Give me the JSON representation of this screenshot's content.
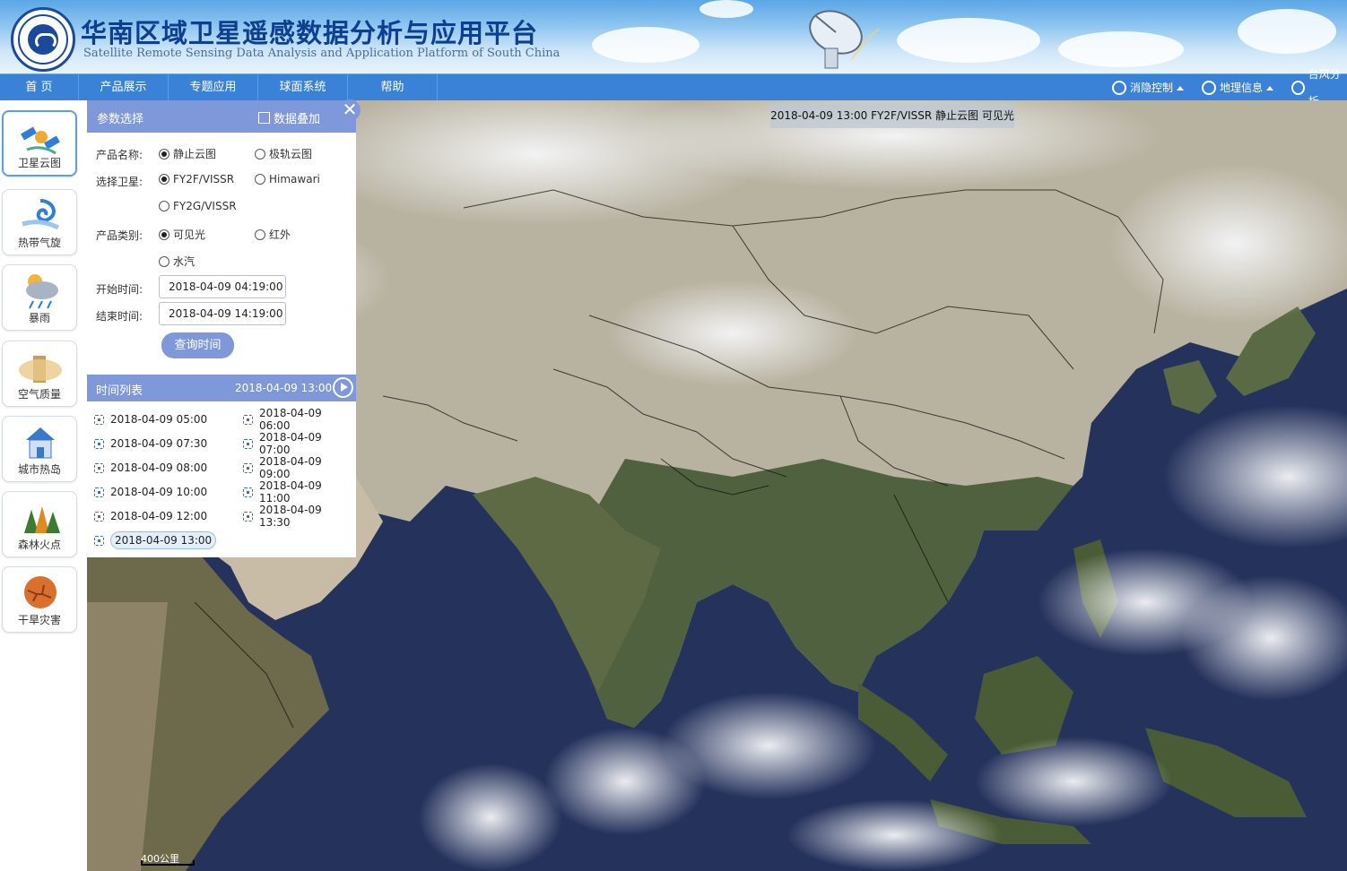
{
  "header": {
    "title": "华南区域卫星遥感数据分析与应用平台",
    "subtitle": "Satellite Remote Sensing Data Analysis and Application Platform of South China"
  },
  "nav": {
    "items": [
      "首 页",
      "产品展示",
      "专题应用",
      "球面系统",
      "帮助"
    ],
    "right": [
      {
        "label": "消隐控制",
        "icon": "gear-icon"
      },
      {
        "label": "地理信息",
        "icon": "globe-icon"
      },
      {
        "label": "台风分析",
        "icon": "typhoon-icon"
      }
    ]
  },
  "sidebar": {
    "items": [
      {
        "label": "卫星云图",
        "icon": "satellite-icon",
        "active": true
      },
      {
        "label": "热带气旋",
        "icon": "cyclone-icon",
        "active": false
      },
      {
        "label": "暴雨",
        "icon": "rainstorm-icon",
        "active": false
      },
      {
        "label": "空气质量",
        "icon": "air-quality-icon",
        "active": false
      },
      {
        "label": "城市热岛",
        "icon": "city-heat-island-icon",
        "active": false
      },
      {
        "label": "森林火点",
        "icon": "forest-fire-icon",
        "active": false
      },
      {
        "label": "干旱灾害",
        "icon": "drought-icon",
        "active": false
      }
    ]
  },
  "params": {
    "title": "参数选择",
    "overlay_label": "数据叠加",
    "close_symbol": "✕",
    "product_name_label": "产品名称:",
    "product_name_options": [
      "静止云图",
      "极轨云图"
    ],
    "satellite_label": "选择卫星:",
    "satellite_options": [
      "FY2F/VISSR",
      "Himawari",
      "FY2G/VISSR"
    ],
    "category_label": "产品类别:",
    "category_options": [
      "可见光",
      "红外",
      "水汽"
    ],
    "start_label": "开始时间:",
    "start_value": "2018-04-09 04:19:00",
    "end_label": "结束时间:",
    "end_value": "2018-04-09 14:19:00",
    "query_button": "查询时间"
  },
  "timelist": {
    "title": "时间列表",
    "current": "2018-04-09 13:00",
    "items": [
      "2018-04-09 05:00",
      "2018-04-09 06:00",
      "2018-04-09 07:30",
      "2018-04-09 07:00",
      "2018-04-09 08:00",
      "2018-04-09 09:00",
      "2018-04-09 10:00",
      "2018-04-09 11:00",
      "2018-04-09 12:00",
      "2018-04-09 13:30",
      "2018-04-09 13:00"
    ],
    "selected": "2018-04-09 13:00"
  },
  "map": {
    "caption": "2018-04-09 13:00 FY2F/VISSR 静止云图 可见光",
    "scale_label": "400公里"
  },
  "colors": {
    "accent": "#7f98d9",
    "nav": "#3a82d8",
    "ocean": "#23315a",
    "land": "#4f5d3a",
    "desert": "#b7ad96",
    "cloud": "#f2f3f5"
  }
}
